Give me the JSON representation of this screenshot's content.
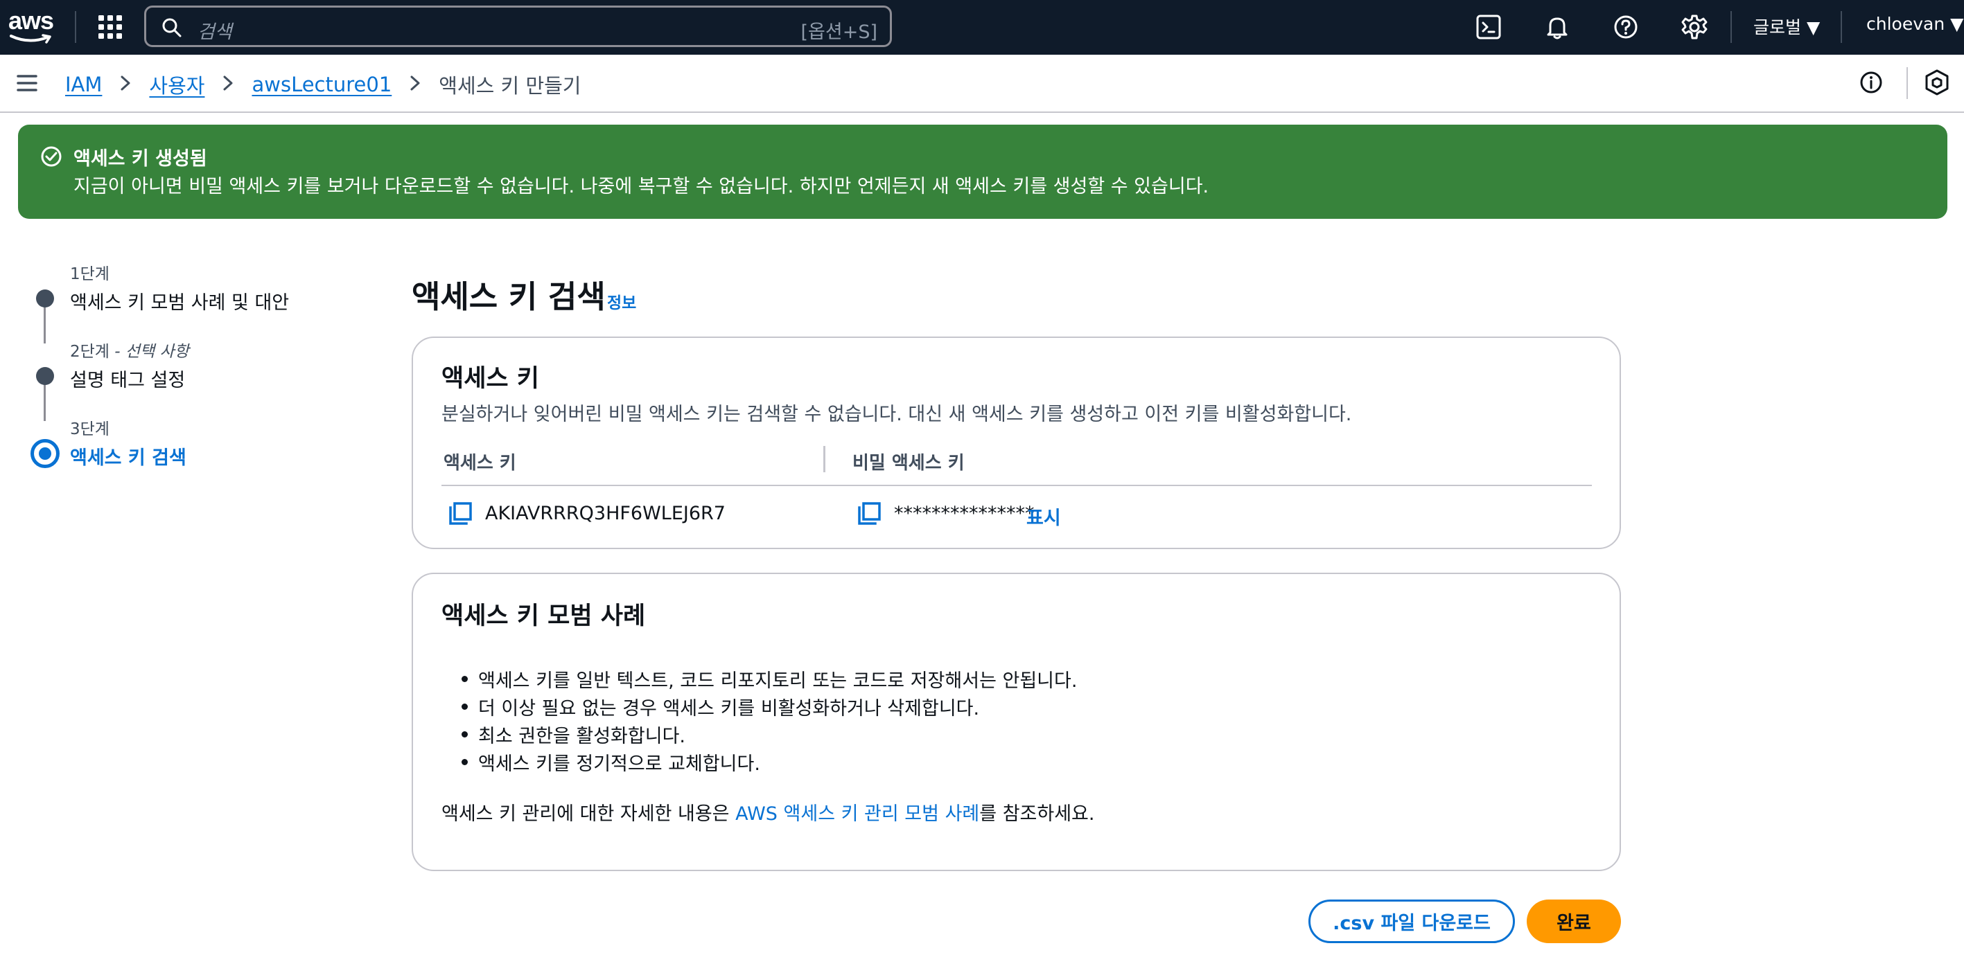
{
  "topnav": {
    "logo_text": "aws",
    "search_placeholder": "검색",
    "search_shortcut": "[옵션+S]",
    "region": "글로벌 ▼",
    "user": "chloevan ▼",
    "icons": [
      "grid-icon",
      "cloudshell-icon",
      "bell-icon",
      "help-icon",
      "gear-icon"
    ]
  },
  "breadcrumb": {
    "items": [
      "IAM",
      "사용자",
      "awsLecture01"
    ],
    "current": "액세스 키 만들기"
  },
  "flash": {
    "title": "액세스 키 생성됨",
    "message": "지금이 아니면 비밀 액세스 키를 보거나 다운로드할 수 없습니다. 나중에 복구할 수 없습니다. 하지만 언제든지 새 액세스 키를 생성할 수 있습니다.",
    "color": "#37833b"
  },
  "steps": [
    {
      "number": "1단계",
      "optional": "",
      "title": "액세스 키 모범 사례 및 대안"
    },
    {
      "number": "2단계",
      "optional": "- 선택 사항",
      "title": "설명 태그 설정"
    },
    {
      "number": "3단계",
      "optional": "",
      "title": "액세스 키 검색"
    }
  ],
  "page": {
    "title": "액세스 키 검색",
    "info_link": "정보"
  },
  "access_key_card": {
    "title": "액세스 키",
    "description": "분실하거나 잊어버린 비밀 액세스 키는 검색할 수 없습니다. 대신 새 액세스 키를 생성하고 이전 키를 비활성화합니다.",
    "col_access_key": "액세스 키",
    "col_secret_key": "비밀 액세스 키",
    "access_key_value": "AKIAVRRRQ3HF6WLEJ6R7",
    "secret_key_masked": "***************",
    "show_label": "표시"
  },
  "best_practices_card": {
    "title": "액세스 키 모범 사례",
    "items": [
      "액세스 키를 일반 텍스트, 코드 리포지토리 또는 코드로 저장해서는 안됩니다.",
      "더 이상 필요 없는 경우 액세스 키를 비활성화하거나 삭제합니다.",
      "최소 권한을 활성화합니다.",
      "액세스 키를 정기적으로 교체합니다."
    ],
    "more_prefix": "액세스 키 관리에 대한 자세한 내용은 ",
    "more_link": "AWS 액세스 키 관리 모범 사례",
    "more_suffix": "를 참조하세요."
  },
  "buttons": {
    "download_csv": ".csv 파일 다운로드",
    "done": "완료"
  },
  "colors": {
    "nav_bg": "#0f1b2a",
    "link": "#0972d3",
    "primary_button": "#ff9900"
  }
}
